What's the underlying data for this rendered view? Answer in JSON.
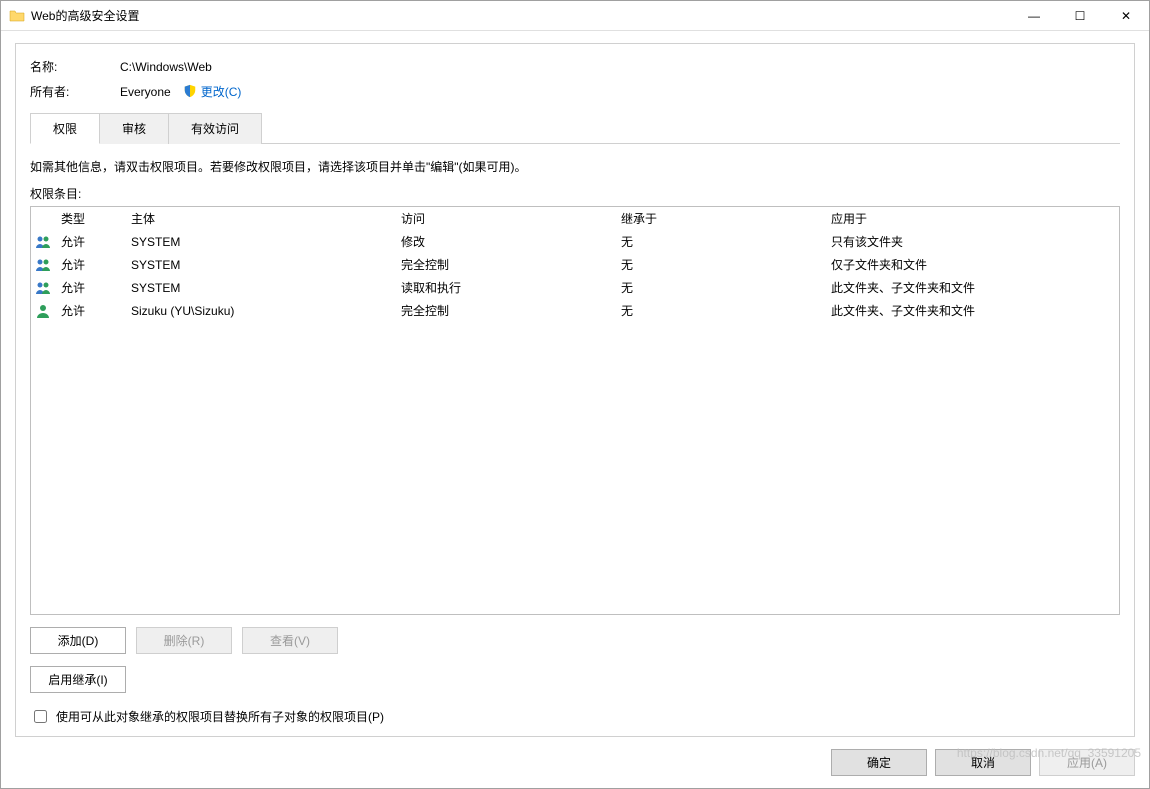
{
  "window": {
    "title": "Web的高级安全设置",
    "minimize": "—",
    "maximize": "☐",
    "close": "✕"
  },
  "fields": {
    "name_label": "名称:",
    "name_value": "C:\\Windows\\Web",
    "owner_label": "所有者:",
    "owner_value": "Everyone",
    "change_link": "更改(C)"
  },
  "tabs": {
    "permissions": "权限",
    "auditing": "审核",
    "effective": "有效访问"
  },
  "instructions": "如需其他信息，请双击权限项目。若要修改权限项目，请选择该项目并单击\"编辑\"(如果可用)。",
  "section_label": "权限条目:",
  "columns": {
    "icon": "",
    "type": "类型",
    "principal": "主体",
    "access": "访问",
    "inherited_from": "继承于",
    "applies_to": "应用于"
  },
  "entries": [
    {
      "icon": "group",
      "type": "允许",
      "principal": "SYSTEM",
      "access": "修改",
      "inherited_from": "无",
      "applies_to": "只有该文件夹"
    },
    {
      "icon": "group",
      "type": "允许",
      "principal": "SYSTEM",
      "access": "完全控制",
      "inherited_from": "无",
      "applies_to": "仅子文件夹和文件"
    },
    {
      "icon": "group",
      "type": "允许",
      "principal": "SYSTEM",
      "access": "读取和执行",
      "inherited_from": "无",
      "applies_to": "此文件夹、子文件夹和文件"
    },
    {
      "icon": "user",
      "type": "允许",
      "principal": "Sizuku (YU\\Sizuku)",
      "access": "完全控制",
      "inherited_from": "无",
      "applies_to": "此文件夹、子文件夹和文件"
    }
  ],
  "buttons": {
    "add": "添加(D)",
    "remove": "删除(R)",
    "view": "查看(V)",
    "enable_inherit": "启用继承(I)",
    "replace_child": "使用可从此对象继承的权限项目替换所有子对象的权限项目(P)",
    "ok": "确定",
    "cancel": "取消",
    "apply": "应用(A)"
  },
  "watermark": "https://blog.csdn.net/qq_33591205"
}
